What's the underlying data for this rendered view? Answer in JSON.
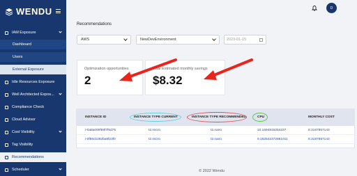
{
  "brand": {
    "name": "WENDU"
  },
  "header": {
    "avatar_initial": "D"
  },
  "sidebar": {
    "items": [
      {
        "label": "IAM Exposure"
      },
      {
        "label": "Dashboard"
      },
      {
        "label": "Users"
      },
      {
        "label": "External Exposure"
      },
      {
        "label": "Idle Resources Exposure"
      },
      {
        "label": "Well Architected Expos..."
      },
      {
        "label": "Compliance Check"
      },
      {
        "label": "Cloud Advisor"
      },
      {
        "label": "Cost Visibility"
      },
      {
        "label": "Tag Visibility"
      },
      {
        "label": "Recommendations"
      },
      {
        "label": "Scheduler"
      }
    ]
  },
  "main": {
    "title": "Recommendations",
    "filters": {
      "provider": "AWS",
      "environment": "NewDevEnvironment",
      "date_placeholder": "2023-01-15"
    },
    "cards": [
      {
        "label": "Optimization opportunities",
        "value": "2"
      },
      {
        "label": "Total Estimated monthly savings",
        "value": "$8.32"
      }
    ],
    "table": {
      "headers": [
        "INSTANCE ID",
        "INSTANCE TYPE CURRENT",
        "INSTANCE TYPE RECOMMENDED",
        "CPU",
        "MONTHLY COST"
      ],
      "rows": [
        [
          "i-0a8a000f69f7f6d75",
          "t2.micro",
          "t2.nano",
          "10.1694815254237",
          "8.3187857143"
        ],
        [
          "i-0f86cb282ba8f23f0",
          "t2.micro",
          "t2.nano",
          "9.152542372881011",
          "8.3187857143"
        ]
      ]
    },
    "highlight_colors": {
      "current": "#5fd1e0",
      "recommended": "#e24c4c",
      "cpu": "#58c94a"
    },
    "annotation_color": "#e8241d"
  },
  "footer": {
    "text": "© 2022 Wendu"
  }
}
